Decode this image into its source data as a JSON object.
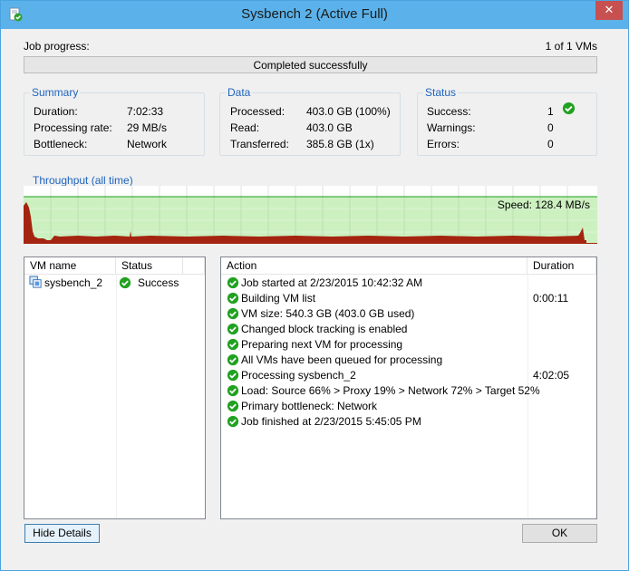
{
  "window": {
    "title": "Sysbench 2 (Active Full)",
    "close_glyph": "✕"
  },
  "progress": {
    "label": "Job progress:",
    "count": "1 of 1 VMs",
    "status": "Completed successfully",
    "percent": 100
  },
  "summary": {
    "title": "Summary",
    "rows": [
      {
        "label": "Duration:",
        "value": "7:02:33"
      },
      {
        "label": "Processing rate:",
        "value": "29 MB/s"
      },
      {
        "label": "Bottleneck:",
        "value": "Network"
      }
    ]
  },
  "data_group": {
    "title": "Data",
    "rows": [
      {
        "label": "Processed:",
        "value": "403.0 GB (100%)"
      },
      {
        "label": "Read:",
        "value": "403.0 GB"
      },
      {
        "label": "Transferred:",
        "value": "385.8 GB (1x)"
      }
    ]
  },
  "status_group": {
    "title": "Status",
    "rows": [
      {
        "label": "Success:",
        "value": "1"
      },
      {
        "label": "Warnings:",
        "value": "0"
      },
      {
        "label": "Errors:",
        "value": "0"
      }
    ]
  },
  "throughput": {
    "title": "Throughput (all time)",
    "speed": "Speed: 128.4 MB/s"
  },
  "vm_table": {
    "headers": {
      "name": "VM name",
      "status": "Status"
    },
    "rows": [
      {
        "name": "sysbench_2",
        "status": "Success"
      }
    ]
  },
  "action_table": {
    "headers": {
      "action": "Action",
      "duration": "Duration"
    },
    "rows": [
      {
        "action": "Job started at 2/23/2015 10:42:32 AM",
        "duration": ""
      },
      {
        "action": "Building VM list",
        "duration": "0:00:11"
      },
      {
        "action": "VM size: 540.3 GB (403.0 GB used)",
        "duration": ""
      },
      {
        "action": "Changed block tracking is enabled",
        "duration": ""
      },
      {
        "action": "Preparing next VM for processing",
        "duration": ""
      },
      {
        "action": "All VMs have been queued for processing",
        "duration": ""
      },
      {
        "action": "Processing sysbench_2",
        "duration": "4:02:05"
      },
      {
        "action": "Load: Source 66% > Proxy 19% > Network 72% > Target 52%",
        "duration": ""
      },
      {
        "action": "Primary bottleneck: Network",
        "duration": ""
      },
      {
        "action": "Job finished at 2/23/2015 5:45:05 PM",
        "duration": ""
      }
    ]
  },
  "buttons": {
    "hide_details": "Hide Details",
    "ok": "OK"
  },
  "colors": {
    "chart_fill": "#ccf0c0",
    "chart_bar": "#a42410",
    "chart_line": "#1aa01a",
    "success_green": "#21a121",
    "accent": "#1f64bf"
  },
  "icons": {
    "app": "job-status-icon",
    "vm": "vm-icon",
    "success": "success-check-icon"
  }
}
